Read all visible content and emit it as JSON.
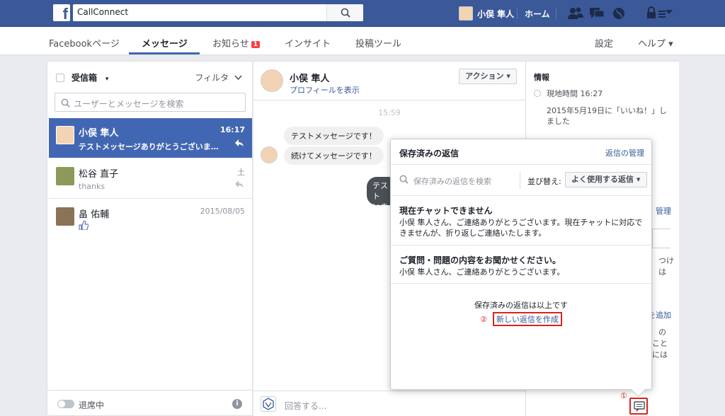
{
  "topbar": {
    "search_value": "CallConnect",
    "user_name": "小俣 隼人",
    "home_label": "ホーム"
  },
  "nav": {
    "tabs": [
      {
        "label": "Facebookページ"
      },
      {
        "label": "メッセージ"
      },
      {
        "label": "お知らせ"
      },
      {
        "label": "インサイト"
      },
      {
        "label": "投稿ツール"
      }
    ],
    "notify_count": "1",
    "settings": "設定",
    "help": "ヘルプ ▾"
  },
  "inbox": {
    "label": "受信箱",
    "dropdown": "▾",
    "filter": "フィルタ",
    "search_placeholder": "ユーザーとメッセージを検索",
    "conversations": [
      {
        "name": "小俣 隼人",
        "time": "16:17",
        "preview": "テストメッセージありがとうございま…"
      },
      {
        "name": "松谷 直子",
        "time": "土",
        "preview": "thanks"
      },
      {
        "name": "畠 佑輔",
        "time": "2015/08/05",
        "preview": ""
      }
    ],
    "away_label": "退席中"
  },
  "chat": {
    "name": "小俣 隼人",
    "profile_link": "プロフィールを表示",
    "action_button": "アクション ▾",
    "timestamp": "15:59",
    "messages": [
      "テストメッセージです！",
      "続けてメッセージです！"
    ],
    "outgoing_fragment": "テスト いま",
    "reply_placeholder": "回答する..."
  },
  "info": {
    "title": "情報",
    "local_time": "現地時間 16:27",
    "liked": "2015年5月19日に「いいね！」しました",
    "fragments": [
      "管理",
      "つけ",
      "は",
      "を追加",
      "の",
      "こと",
      "には"
    ]
  },
  "saved_replies": {
    "title": "保存済みの返信",
    "manage": "返信の管理",
    "search_placeholder": "保存済みの返信を検索",
    "sort_label": "並び替え:",
    "sort_value": "よく使用する返信 ▾",
    "items": [
      {
        "title": "現在チャットできません",
        "body": "小俣 隼人さん、ご連絡ありがとうございます。現在チャットに対応できませんが、折り返しご連絡いたします。"
      },
      {
        "title": "ご質問・問題の内容をお聞かせください。",
        "body": "小俣 隼人さん、ご連絡ありがとうございます。"
      }
    ],
    "end_text": "保存済みの返信は以上です",
    "marker2": "②",
    "new_reply": "新しい返信を作成"
  },
  "annotations": {
    "marker1": "①"
  },
  "colors": {
    "brand": "#3b5998",
    "accent": "#4267b2",
    "highlight": "#d9251d"
  }
}
